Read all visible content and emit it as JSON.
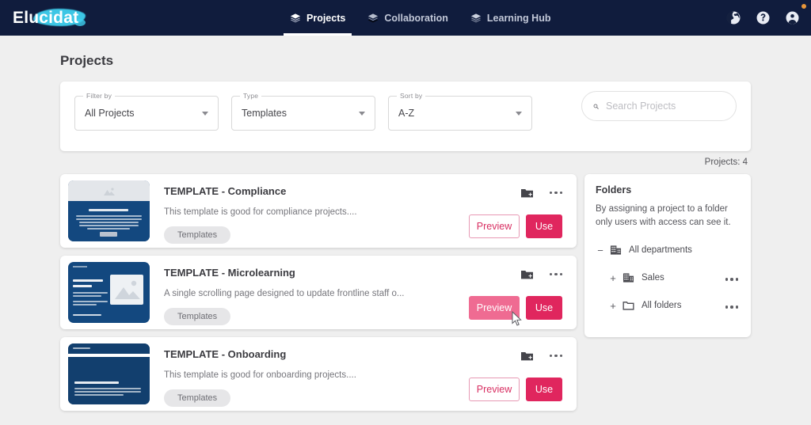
{
  "brand": {
    "name": "Elucidat",
    "accent": "#3fd0ef"
  },
  "topnav": {
    "items": [
      {
        "label": "Projects",
        "icon": "layers-icon",
        "active": true
      },
      {
        "label": "Collaboration",
        "icon": "layers-icon",
        "active": false
      },
      {
        "label": "Learning Hub",
        "icon": "layers-icon",
        "active": false
      }
    ],
    "actions": [
      {
        "name": "globe-icon"
      },
      {
        "name": "help-icon"
      },
      {
        "name": "account-icon"
      }
    ]
  },
  "page": {
    "title": "Projects",
    "count_label": "Projects: 4"
  },
  "filters": {
    "filter_by": {
      "label": "Filter by",
      "value": "All Projects"
    },
    "type": {
      "label": "Type",
      "value": "Templates"
    },
    "sort_by": {
      "label": "Sort by",
      "value": "A-Z"
    }
  },
  "search": {
    "placeholder": "Search Projects",
    "value": ""
  },
  "buttons": {
    "preview": "Preview",
    "use": "Use"
  },
  "colors": {
    "nav_bg": "#101c3d",
    "accent_pink": "#e0265e",
    "accent_pink_hover": "#ef6b92",
    "thumb_navy": "#13487f"
  },
  "cards": [
    {
      "title": "TEMPLATE - Compliance",
      "description": "This template is good for compliance projects....",
      "tag": "Templates",
      "preview_hovered": false
    },
    {
      "title": "TEMPLATE - Microlearning",
      "description": "A single scrolling page designed to update frontline staff o...",
      "tag": "Templates",
      "preview_hovered": true
    },
    {
      "title": "TEMPLATE - Onboarding",
      "description": "This template is good for onboarding projects....",
      "tag": "Templates",
      "preview_hovered": false
    }
  ],
  "folders": {
    "title": "Folders",
    "description": "By assigning a project to a folder only users with access can see it.",
    "tree": [
      {
        "toggle": "−",
        "label": "All departments",
        "icon": "departments-icon",
        "indent": false,
        "menu": false
      },
      {
        "toggle": "+",
        "label": "Sales",
        "icon": "departments-icon",
        "indent": true,
        "menu": true
      },
      {
        "toggle": "+",
        "label": "All folders",
        "icon": "folder-icon",
        "indent": true,
        "menu": true
      }
    ]
  }
}
